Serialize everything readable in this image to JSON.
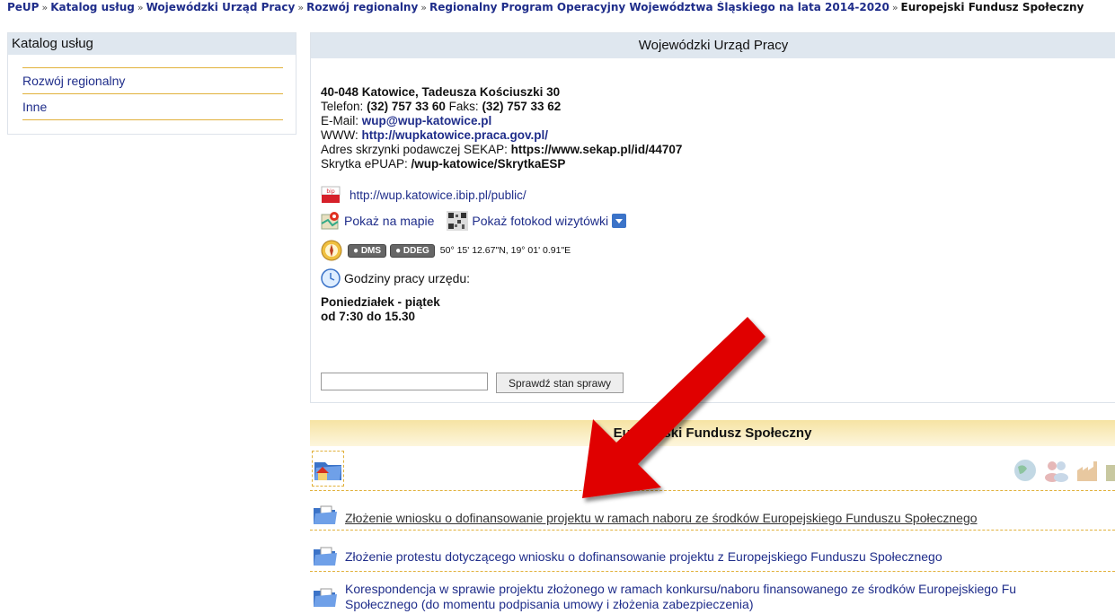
{
  "breadcrumb": {
    "items": [
      "PeUP",
      "Katalog usług",
      "Wojewódzki Urząd Pracy",
      "Rozwój regionalny",
      "Regionalny Program Operacyjny Województwa Śląskiego na lata 2014-2020"
    ],
    "current": "Europejski Fundusz Społeczny",
    "separator": "»"
  },
  "sidebar": {
    "title": "Katalog usług",
    "items": [
      "Rozwój regionalny",
      "Inne"
    ]
  },
  "office": {
    "title": "Wojewódzki Urząd Pracy",
    "address": "40-048 Katowice, Tadeusza Kościuszki 30",
    "phone_label": "Telefon:",
    "phone": "(32) 757 33 60",
    "fax_label": "Faks:",
    "fax": "(32) 757 33 62",
    "email_label": "E-Mail:",
    "email": "wup@wup-katowice.pl",
    "www_label": "WWW:",
    "www": "http://wupkatowice.praca.gov.pl/",
    "sekap_label": "Adres skrzynki podawczej SEKAP:",
    "sekap": "https://www.sekap.pl/id/44707",
    "epuap_label": "Skrytka ePUAP:",
    "epuap": "/wup-katowice/SkrytkaESP",
    "bip_icon_text": "bip",
    "bip": "http://wup.katowice.ibip.pl/public/",
    "map_link": "Pokaż na mapie",
    "qr_link": "Pokaż fotokod wizytówki",
    "dms_label": "DMS",
    "ddeg_label": "DDEG",
    "coordinates": "50° 15' 12.67\"N, 19° 01' 0.91\"E",
    "hours_label": "Godziny pracy urzędu:",
    "hours_days": "Poniedziałek - piątek",
    "hours_time": "od 7:30 do 15.30",
    "case_input_value": "",
    "case_button": "Sprawdź stan sprawy"
  },
  "efs": {
    "title": "Europejski Fundusz Społeczny",
    "items": [
      "Złożenie wniosku o dofinansowanie projektu w ramach naboru ze środków Europejskiego Funduszu Społecznego",
      "Złożenie protestu dotyczącego wniosku o dofinansowanie projektu z Europejskiego Funduszu Społecznego",
      "Korespondencja w sprawie projektu złożonego w ramach konkursu/naboru finansowanego ze środków Europejskiego Funduszu Społecznego (do momentu podpisania umowy i złożenia zabezpieczenia)"
    ],
    "item3_line1": "Korespondencja w sprawie projektu złożonego w ramach konkursu/naboru finansowanego ze środków Europejskiego Fu",
    "item3_line2": "Społecznego (do momentu podpisania umowy i złożenia zabezpieczenia)"
  },
  "colors": {
    "link": "#1f2d8a",
    "header_bg": "#dfe7ef",
    "accent_line": "#e1b13b",
    "arrow": "#e00000"
  }
}
